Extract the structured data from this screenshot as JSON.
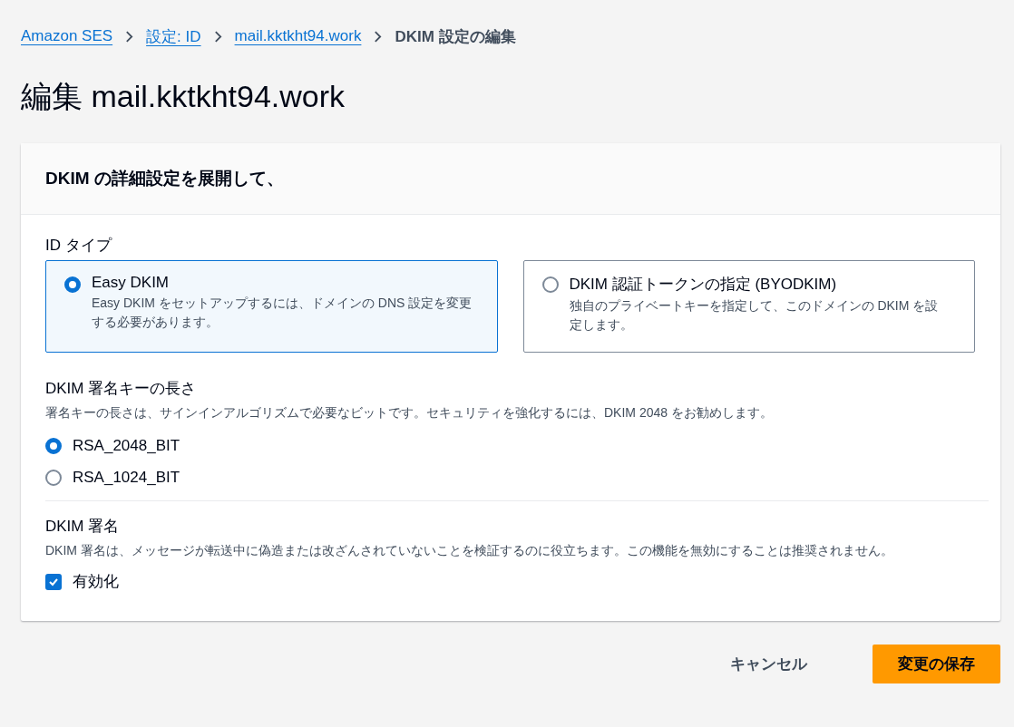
{
  "breadcrumbs": [
    {
      "label": "Amazon SES",
      "link": true
    },
    {
      "label": "設定: ID",
      "link": true
    },
    {
      "label": "mail.kktkht94.work",
      "link": true
    },
    {
      "label": "DKIM 設定の編集",
      "link": false
    }
  ],
  "title": "編集 mail.kktkht94.work",
  "panel": {
    "header": "DKIM の詳細設定を展開して、",
    "identity_type": {
      "label": "ID タイプ",
      "options": [
        {
          "title": "Easy DKIM",
          "description": "Easy DKIM をセットアップするには、ドメインの DNS 設定を変更する必要があります。",
          "selected": true
        },
        {
          "title": "DKIM 認証トークンの指定 (BYODKIM)",
          "description": "独自のプライベートキーを指定して、このドメインの DKIM を設定します。",
          "selected": false
        }
      ]
    },
    "key_length": {
      "label": "DKIM 署名キーの長さ",
      "description": "署名キーの長さは、サインインアルゴリズムで必要なビットです。セキュリティを強化するには、DKIM 2048 をお勧めします。",
      "options": [
        {
          "label": "RSA_2048_BIT",
          "selected": true
        },
        {
          "label": "RSA_1024_BIT",
          "selected": false
        }
      ]
    },
    "signing": {
      "label": "DKIM 署名",
      "description": "DKIM 署名は、メッセージが転送中に偽造または改ざんされていないことを検証するのに役立ちます。この機能を無効にすることは推奨されません。",
      "checkbox": {
        "label": "有効化",
        "checked": true
      }
    }
  },
  "buttons": [
    {
      "label": "キャンセル",
      "kind": "link"
    },
    {
      "label": "変更の保存",
      "kind": "primary"
    }
  ]
}
